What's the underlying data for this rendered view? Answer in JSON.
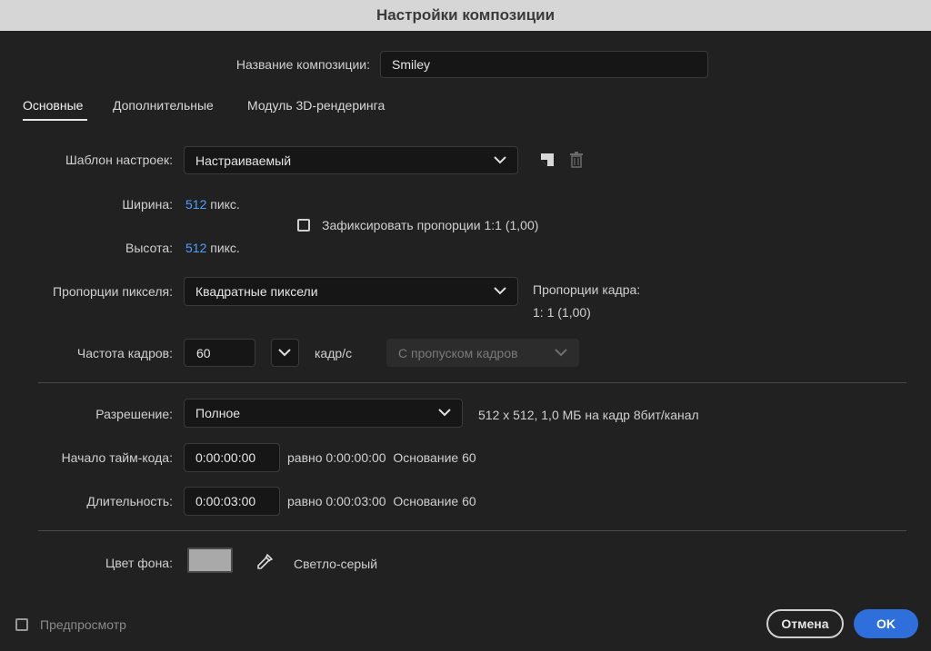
{
  "window": {
    "title": "Настройки композиции"
  },
  "comp_name": {
    "label": "Название композиции:",
    "value": "Smiley"
  },
  "tabs": [
    {
      "label": "Основные",
      "active": true
    },
    {
      "label": "Дополнительные",
      "active": false
    },
    {
      "label": "Модуль 3D-рендеринга",
      "active": false
    }
  ],
  "preset": {
    "label": "Шаблон настроек:",
    "value": "Настраиваемый",
    "save_icon": "save-preset-icon",
    "delete_icon": "trash-icon"
  },
  "width": {
    "label": "Ширина:",
    "value": "512",
    "unit": "пикс."
  },
  "height": {
    "label": "Высота:",
    "value": "512",
    "unit": "пикс."
  },
  "lock_aspect": {
    "label": "Зафиксировать пропорции 1:1 (1,00)",
    "checked": false
  },
  "pixel_aspect": {
    "label": "Пропорции пикселя:",
    "value": "Квадратные пиксели",
    "frame_aspect_label": "Пропорции кадра:",
    "frame_aspect_value": "1: 1 (1,00)"
  },
  "frame_rate": {
    "label": "Частота кадров:",
    "value": "60",
    "unit": "кадр/с",
    "drop_frame": "С пропуском кадров"
  },
  "resolution": {
    "label": "Разрешение:",
    "value": "Полное",
    "info": "512 x 512, 1,0 МБ на кадр 8бит/канал"
  },
  "timecode_start": {
    "label": "Начало тайм-кода:",
    "value": "0:00:00:00",
    "info": "равно 0:00:00:00  Основание 60"
  },
  "duration": {
    "label": "Длительность:",
    "value": "0:00:03:00",
    "info": "равно 0:00:03:00  Основание 60"
  },
  "background": {
    "label": "Цвет фона:",
    "color": "#a9a9a9",
    "name": "Светло-серый"
  },
  "preview": {
    "label": "Предпросмотр",
    "checked": false
  },
  "buttons": {
    "cancel": "Отмена",
    "ok": "OK"
  },
  "colors": {
    "accent": "#2f6fdc",
    "link": "#4ea1ff"
  }
}
